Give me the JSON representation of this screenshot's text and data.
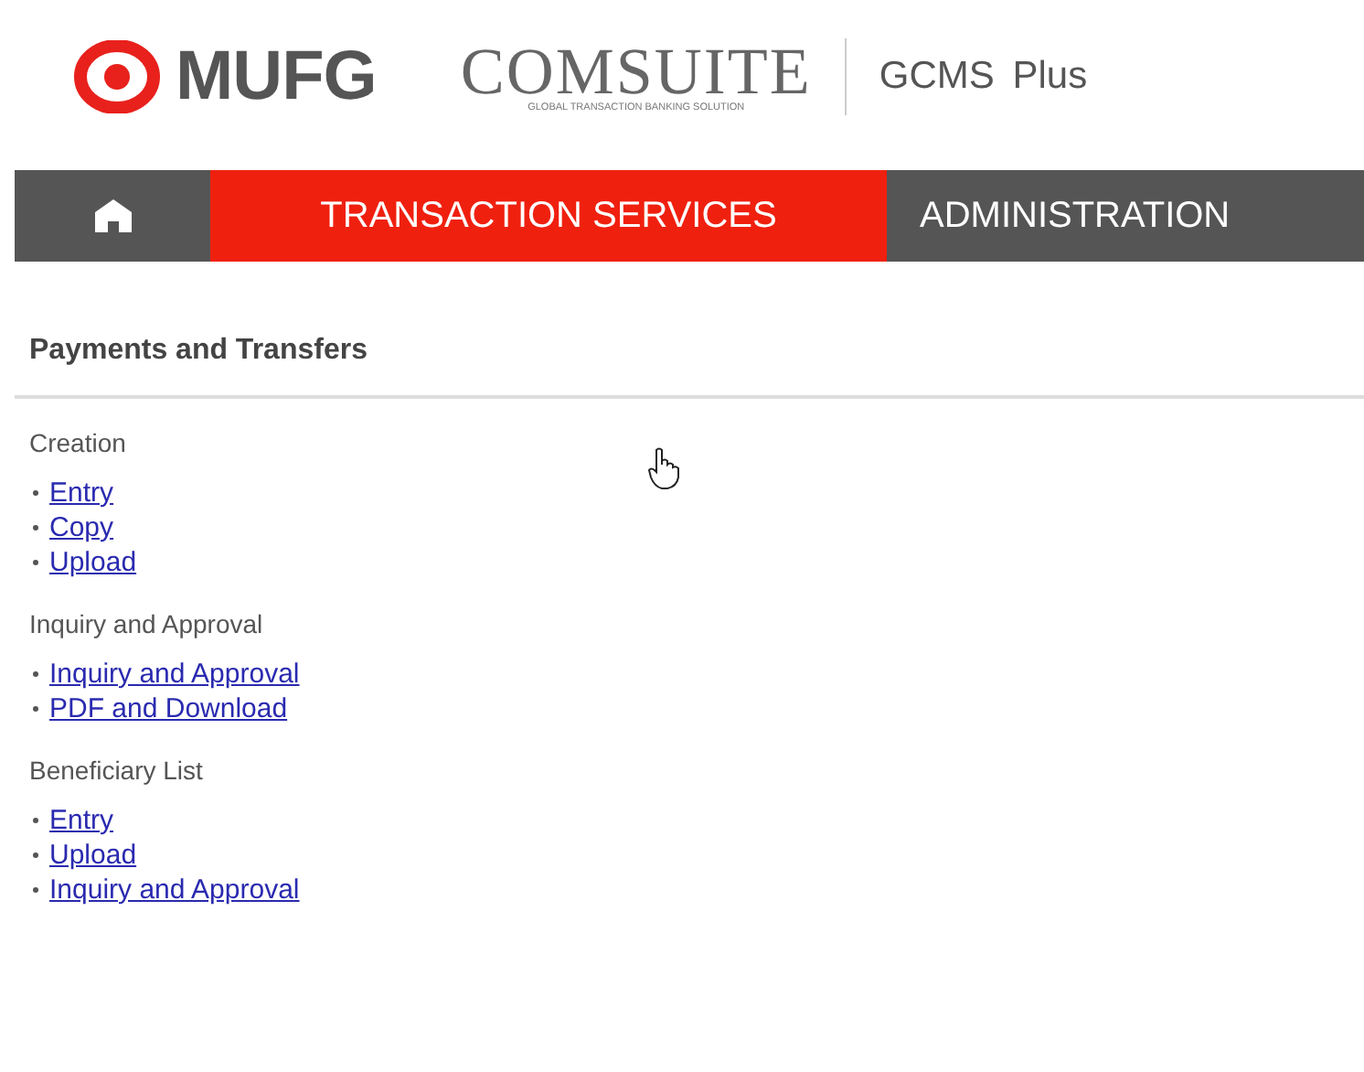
{
  "header": {
    "brand": "MUFG",
    "product": "COMSUITE",
    "tagline": "GLOBAL TRANSACTION BANKING SOLUTION",
    "edition": "GCMS Plus"
  },
  "nav": [
    {
      "kind": "home",
      "selected": false
    },
    {
      "kind": "text",
      "label": "TRANSACTION SERVICES",
      "selected": true
    },
    {
      "kind": "text",
      "label": "ADMINISTRATION",
      "selected": false
    }
  ],
  "page_title": "Payments and Transfers",
  "sections": [
    {
      "title": "Creation",
      "links": [
        "Entry",
        "Copy",
        "Upload"
      ]
    },
    {
      "title": "Inquiry and Approval",
      "links": [
        "Inquiry and Approval",
        "PDF and Download"
      ]
    },
    {
      "title": "Beneficiary List",
      "links": [
        "Entry",
        "Upload",
        "Inquiry and Approval"
      ]
    }
  ]
}
